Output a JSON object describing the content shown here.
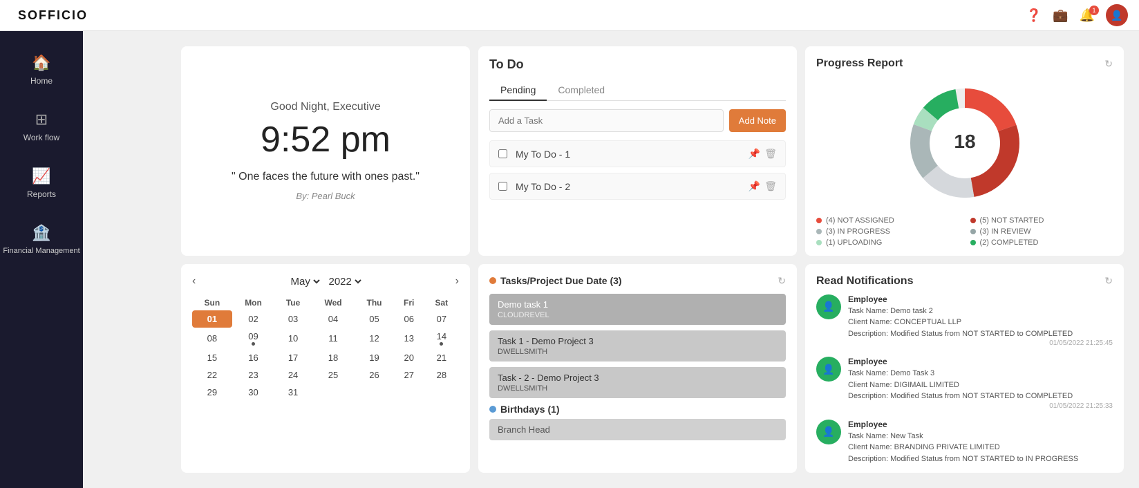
{
  "topbar": {
    "logo": "SOFFICIO",
    "notification_count": "1"
  },
  "sidebar": {
    "items": [
      {
        "id": "home",
        "label": "Home",
        "icon": "🏠"
      },
      {
        "id": "workflow",
        "label": "Work flow",
        "icon": "⊞"
      },
      {
        "id": "reports",
        "label": "Reports",
        "icon": "📈"
      },
      {
        "id": "financial",
        "label": "Financial Management",
        "icon": "🏦"
      }
    ]
  },
  "welcome": {
    "greeting": "Good Night, Executive",
    "time": "9:52 pm",
    "quote": "\" One faces the future with ones past.\"",
    "quote_author": "By: Pearl Buck"
  },
  "todo": {
    "title": "To Do",
    "tab_pending": "Pending",
    "tab_completed": "Completed",
    "add_placeholder": "Add a Task",
    "add_btn": "Add Note",
    "items": [
      {
        "label": "My To Do - 1",
        "pinned": true
      },
      {
        "label": "My To Do - 2",
        "pinned": false
      }
    ]
  },
  "progress": {
    "title": "Progress Report",
    "center_value": "18",
    "refresh_icon": "↻",
    "legend": [
      {
        "color": "#e74c3c",
        "count": "4",
        "label": "NOT ASSIGNED"
      },
      {
        "color": "#e74c3c",
        "count": "5",
        "label": "NOT STARTED"
      },
      {
        "color": "#95a5a6",
        "count": "3",
        "label": "IN PROGRESS"
      },
      {
        "color": "#95a5a6",
        "count": "3",
        "label": "IN REVIEW"
      },
      {
        "color": "#27ae60",
        "count": "1",
        "label": "UPLOADING"
      },
      {
        "color": "#27ae60",
        "count": "2",
        "label": "COMPLETED"
      }
    ],
    "donut_segments": [
      {
        "color": "#e74c3c",
        "value": 4
      },
      {
        "color": "#c0392b",
        "value": 5
      },
      {
        "color": "#bdc3c7",
        "value": 3
      },
      {
        "color": "#95a5a6",
        "value": 3
      },
      {
        "color": "#a8d5b5",
        "value": 1
      },
      {
        "color": "#27ae60",
        "value": 2
      }
    ]
  },
  "calendar": {
    "month": "May",
    "year": "2022",
    "days_header": [
      "Sun",
      "Mon",
      "Tue",
      "Wed",
      "Thu",
      "Fri",
      "Sat"
    ],
    "weeks": [
      [
        "01",
        "02",
        "03",
        "04",
        "05",
        "06",
        "07"
      ],
      [
        "08",
        "09",
        "10",
        "11",
        "12",
        "13",
        "14"
      ],
      [
        "15",
        "16",
        "17",
        "18",
        "19",
        "20",
        "21"
      ],
      [
        "22",
        "23",
        "24",
        "25",
        "26",
        "27",
        "28"
      ],
      [
        "29",
        "30",
        "31",
        "",
        "",
        "",
        ""
      ]
    ],
    "dots": [
      "09",
      "14"
    ],
    "today": "01"
  },
  "tasks": {
    "section1_title": "Tasks/Project Due Date (3)",
    "section2_title": "Birthdays (1)",
    "task_items": [
      {
        "title": "Demo task 1",
        "sub": "CLOUDREVEL"
      },
      {
        "title": "Task 1 - Demo Project 3",
        "sub": "DWELLSMITH"
      },
      {
        "title": "Task - 2 - Demo Project 3",
        "sub": "DWELLSMITH"
      }
    ],
    "birthday_items": [
      {
        "title": "Branch Head"
      }
    ]
  },
  "notifications": {
    "title": "Read Notifications",
    "refresh_icon": "↻",
    "items": [
      {
        "role": "Employee",
        "task_name": "Demo task 2",
        "client": "CONCEPTUAL LLP",
        "description": "Modified Status from NOT STARTED to COMPLETED",
        "time": "01/05/2022 21:25:45"
      },
      {
        "role": "Employee",
        "task_name": "Demo Task 3",
        "client": "DIGIMAIL LIMITED",
        "description": "Modified Status from NOT STARTED to COMPLETED",
        "time": "01/05/2022 21:25:33"
      },
      {
        "role": "Employee",
        "task_name": "New Task",
        "client": "BRANDING PRIVATE LIMITED",
        "description": "Modified Status from NOT STARTED to IN PROGRESS",
        "time": ""
      }
    ]
  }
}
